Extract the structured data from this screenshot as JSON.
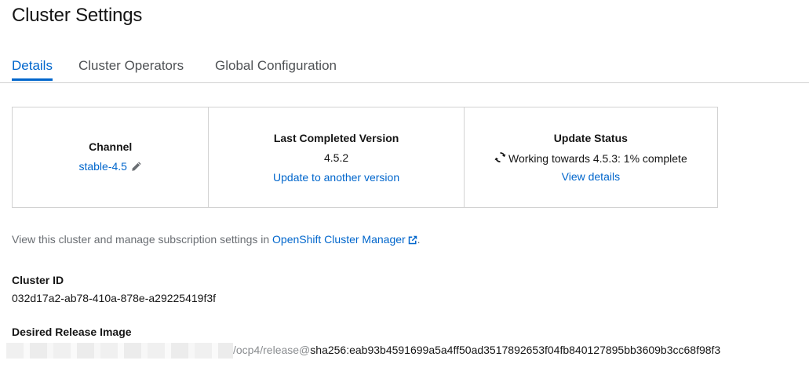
{
  "page": {
    "title": "Cluster Settings"
  },
  "tabs": [
    {
      "label": "Details",
      "active": true
    },
    {
      "label": "Cluster Operators",
      "active": false
    },
    {
      "label": "Global Configuration",
      "active": false
    }
  ],
  "summary": {
    "channel": {
      "heading": "Channel",
      "value": "stable-4.5",
      "edit_icon": "pencil-icon"
    },
    "last_completed": {
      "heading": "Last Completed Version",
      "version": "4.5.2",
      "update_link": "Update to another version"
    },
    "update_status": {
      "heading": "Update Status",
      "status_icon": "sync-icon",
      "status_text": "Working towards 4.5.3: 1% complete",
      "details_link": "View details"
    }
  },
  "ocm": {
    "prefix": "View this cluster and manage subscription settings in ",
    "link": "OpenShift Cluster Manager",
    "link_icon": "external-link-icon",
    "suffix": "."
  },
  "cluster_id": {
    "label": "Cluster ID",
    "value": "032d17a2-ab78-410a-878e-a29225419f3f"
  },
  "release_image": {
    "label": "Desired Release Image",
    "path_muted": "/ocp4/release@",
    "digest": "sha256:eab93b4591699a5a4ff50ad3517892653f04fb840127895bb3609b3cc68f98f3"
  },
  "colors": {
    "link": "#0066cc",
    "text": "#151515",
    "border": "#d2d2d2",
    "muted": "#6a6e73"
  }
}
